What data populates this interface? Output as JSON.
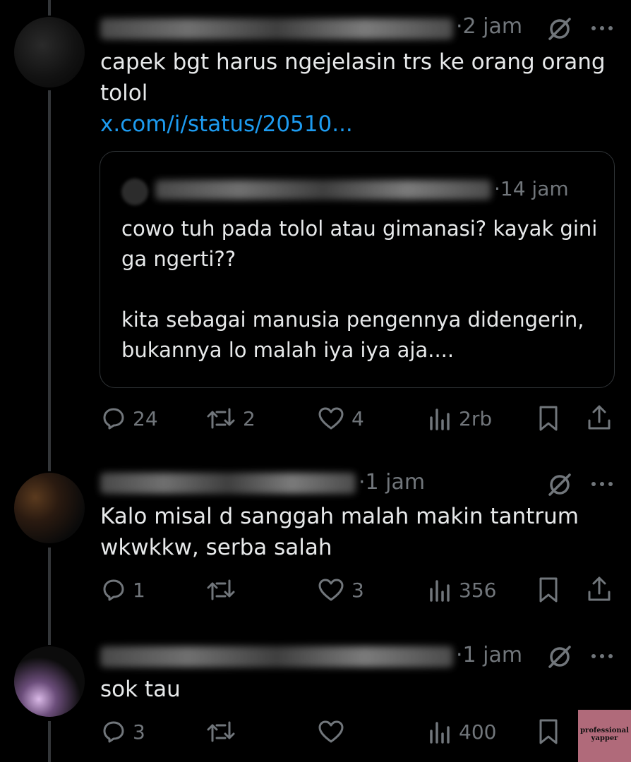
{
  "tweets": [
    {
      "time": "2 jam",
      "text": "capek bgt harus ngejelasin trs ke orang orang tolol",
      "link": "x.com/i/status/20510...",
      "quote": {
        "time": "14 jam",
        "text": "cowo tuh pada tolol atau gimanasi? kayak gini ga ngerti??\n\nkita sebagai manusia pengennya didengerin, bukannya lo malah iya iya aja...."
      },
      "actions": {
        "replies": "24",
        "reposts": "2",
        "likes": "4",
        "views": "2rb"
      }
    },
    {
      "time": "1 jam",
      "text": "Kalo misal d sanggah malah makin tantrum wkwkkw, serba salah",
      "actions": {
        "replies": "1",
        "reposts": "",
        "likes": "3",
        "views": "356"
      }
    },
    {
      "time": "1 jam",
      "text": "sok tau",
      "actions": {
        "replies": "3",
        "reposts": "",
        "likes": "",
        "views": "400"
      }
    }
  ],
  "watermark": {
    "line1": "professional",
    "line2": "yapper"
  },
  "colors": {
    "background": "#000000",
    "text": "#e7e9ea",
    "muted": "#71767b",
    "link": "#1d9bf0",
    "divider": "#2f3336"
  }
}
